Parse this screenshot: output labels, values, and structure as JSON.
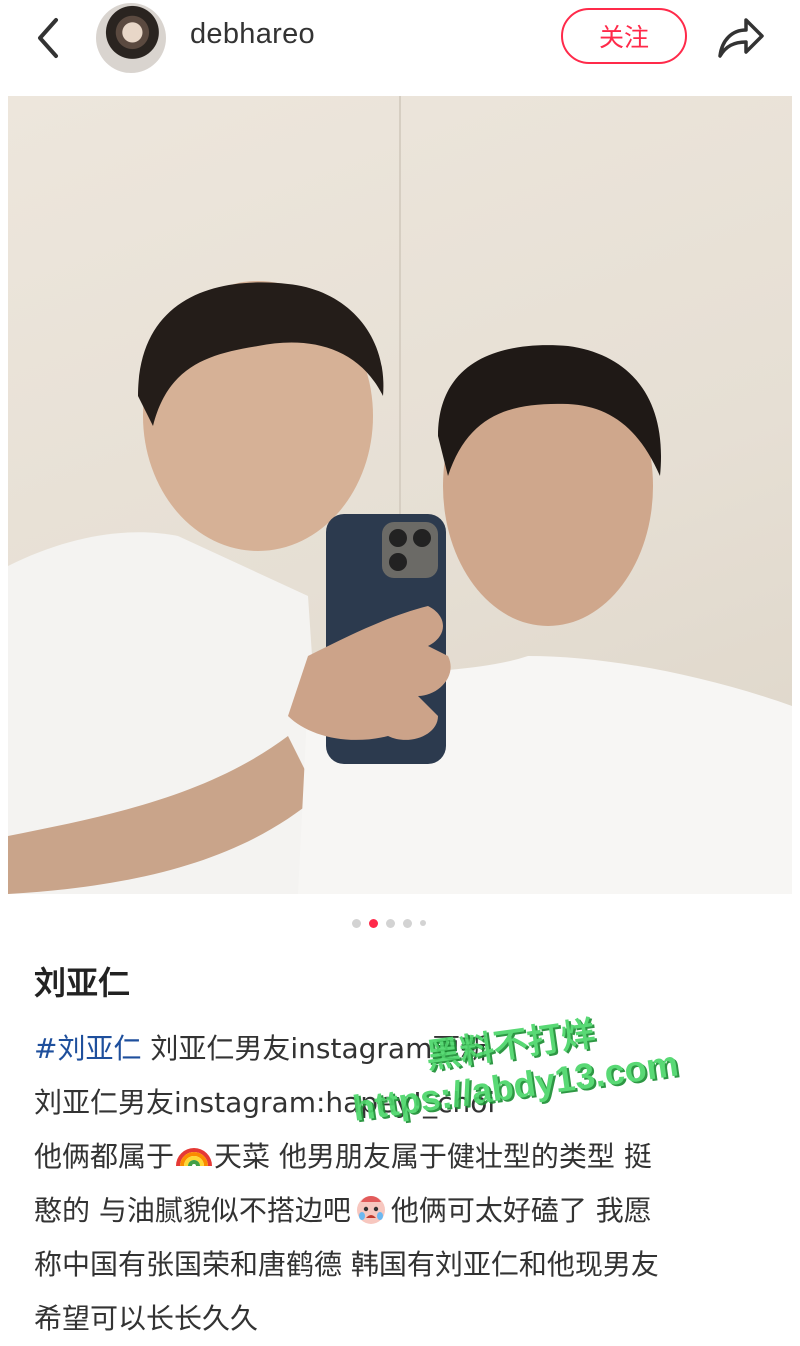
{
  "header": {
    "username": "debhareo",
    "follow_label": "关注"
  },
  "carousel": {
    "total": 5,
    "active_index": 1
  },
  "post": {
    "title": "刘亚仁",
    "lines": {
      "l1_tag": "#刘亚仁",
      "l1_text": "刘亚仁男友instagram更新",
      "l2": "刘亚仁男友instagram:hapey!_choi",
      "l3a": "他俩都属于",
      "l3b": "天菜 他男朋友属于健壮型的类型 挺",
      "l4a": "憨的 与油腻貌似不搭边吧",
      "l4b": "他俩可太好磕了 我愿",
      "l5": "称中国有张国荣和唐鹤德 韩国有刘亚仁和他现男友",
      "l6": "希望可以长长久久"
    }
  },
  "watermark": {
    "line1": "黑料不打烊",
    "line2": "https://abdy13.com"
  },
  "colors": {
    "accent": "#ff2a4a",
    "hashtag": "#1e4f9c",
    "watermark": "#4cd66a"
  },
  "icons": [
    "back-arrow-icon",
    "share-icon",
    "rainbow-emoji-icon",
    "crying-emoji-icon"
  ]
}
